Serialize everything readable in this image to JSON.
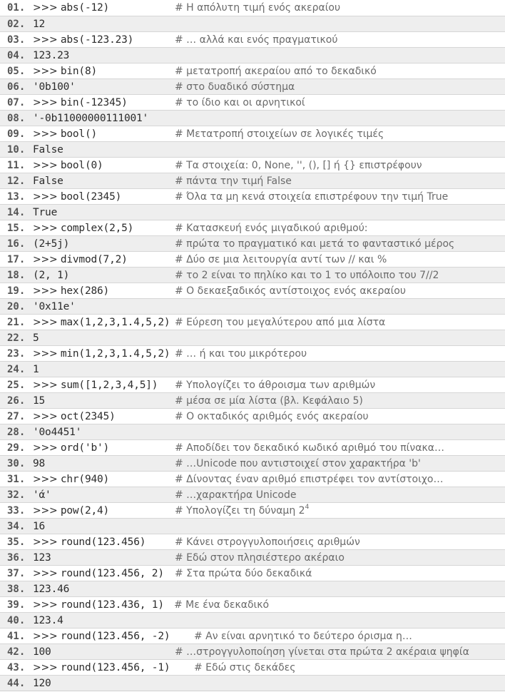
{
  "listing": {
    "lines": [
      {
        "num": "01.",
        "prompt": ">>>",
        "code": "abs(-12)",
        "comment": "# Η απόλυτη τιμή ενός ακεραίου"
      },
      {
        "num": "02.",
        "prompt": "",
        "code": "12",
        "comment": ""
      },
      {
        "num": "03.",
        "prompt": ">>>",
        "code": "abs(-123.23)",
        "comment": "# … αλλά και ενός πραγματικού"
      },
      {
        "num": "04.",
        "prompt": "",
        "code": "123.23",
        "comment": ""
      },
      {
        "num": "05.",
        "prompt": ">>>",
        "code": "bin(8)",
        "comment": "# μετατροπή ακεραίου από το δεκαδικό"
      },
      {
        "num": "06.",
        "prompt": "",
        "code": "'0b100'",
        "comment": "# στο δυαδικό σύστημα"
      },
      {
        "num": "07.",
        "prompt": ">>>",
        "code": "bin(-12345)",
        "comment": "# το ίδιο και οι αρνητικοί"
      },
      {
        "num": "08.",
        "prompt": "",
        "code": "'-0b11000000111001'",
        "comment": ""
      },
      {
        "num": "09.",
        "prompt": ">>>",
        "code": "bool()",
        "comment": "# Μετατροπή στοιχείων σε λογικές τιμές"
      },
      {
        "num": "10.",
        "prompt": "",
        "code": "False",
        "comment": ""
      },
      {
        "num": "11.",
        "prompt": ">>>",
        "code": "bool(0)",
        "comment": "# Τα στοιχεία: 0, None, '', (), [] ή {} επιστρέφουν"
      },
      {
        "num": "12.",
        "prompt": "",
        "code": "False",
        "comment": "# πάντα την τιμή False"
      },
      {
        "num": "13.",
        "prompt": ">>>",
        "code": "bool(2345)",
        "comment": "# Όλα τα μη κενά στοιχεία επιστρέφουν την τιμή True"
      },
      {
        "num": "14.",
        "prompt": "",
        "code": "True",
        "comment": ""
      },
      {
        "num": "15.",
        "prompt": ">>>",
        "code": "complex(2,5)",
        "comment": "# Κατασκευή ενός μιγαδικού αριθμού:"
      },
      {
        "num": "16.",
        "prompt": "",
        "code": "(2+5j)",
        "comment": "# πρώτα το πραγματικό και μετά το φανταστικό μέρος"
      },
      {
        "num": "17.",
        "prompt": ">>>",
        "code": "divmod(7,2)",
        "comment": "# Δύο σε μια λειτουργία αντί των // και %"
      },
      {
        "num": "18.",
        "prompt": "",
        "code": "(2, 1)",
        "comment": "# το 2 είναι το πηλίκο και το 1 το υπόλοιπο του 7//2"
      },
      {
        "num": "19.",
        "prompt": ">>>",
        "code": "hex(286)",
        "comment": "# Ο δεκαεξαδικός αντίστοιχος ενός ακεραίου"
      },
      {
        "num": "20.",
        "prompt": "",
        "code": "'0x11e'",
        "comment": ""
      },
      {
        "num": "21.",
        "prompt": ">>>",
        "code": "max(1,2,3,1.4,5,2)",
        "comment": "# Εύρεση του μεγαλύτερου από μια λίστα"
      },
      {
        "num": "22.",
        "prompt": "",
        "code": "5",
        "comment": ""
      },
      {
        "num": "23.",
        "prompt": ">>>",
        "code": "min(1,2,3,1.4,5,2)",
        "comment": "# … ή και του μικρότερου"
      },
      {
        "num": "24.",
        "prompt": "",
        "code": "1",
        "comment": ""
      },
      {
        "num": "25.",
        "prompt": ">>>",
        "code": "sum([1,2,3,4,5])",
        "comment": "# Υπολογίζει το άθροισμα των αριθμών"
      },
      {
        "num": "26.",
        "prompt": "",
        "code": "15",
        "comment": "# μέσα σε μία λίστα (βλ. Κεφάλαιο 5)"
      },
      {
        "num": "27.",
        "prompt": ">>>",
        "code": "oct(2345)",
        "comment": "# Ο οκταδικός αριθμός ενός ακεραίου"
      },
      {
        "num": "28.",
        "prompt": "",
        "code": "'0o4451'",
        "comment": ""
      },
      {
        "num": "29.",
        "prompt": ">>>",
        "code": "ord('b')",
        "comment": "# Αποδίδει τον δεκαδικό κωδικό αριθμό του πίνακα…"
      },
      {
        "num": "30.",
        "prompt": "",
        "code": "98",
        "comment": "# …Unicode που αντιστοιχεί στον χαρακτήρα 'b'"
      },
      {
        "num": "31.",
        "prompt": ">>>",
        "code": "chr(940)",
        "comment": "# Δίνοντας έναν αριθμό επιστρέφει τον αντίστοιχο…"
      },
      {
        "num": "32.",
        "prompt": "",
        "code": "'ά'",
        "comment": "# …χαρακτήρα Unicode"
      },
      {
        "num": "33.",
        "prompt": ">>>",
        "code": "pow(2,4)",
        "comment": "# Υπολογίζει τη δύναμη 2",
        "sup": "4"
      },
      {
        "num": "34.",
        "prompt": "",
        "code": "16",
        "comment": ""
      },
      {
        "num": "35.",
        "prompt": ">>>",
        "code": "round(123.456)",
        "comment": "# Κάνει στρογγυλοποιήσεις αριθμών"
      },
      {
        "num": "36.",
        "prompt": "",
        "code": "123",
        "comment": "# Εδώ στον πλησιέστερο ακέραιο"
      },
      {
        "num": "37.",
        "prompt": ">>>",
        "code": "round(123.456, 2)",
        "comment": "# Στα πρώτα δύο δεκαδικά"
      },
      {
        "num": "38.",
        "prompt": "",
        "code": "123.46",
        "comment": ""
      },
      {
        "num": "39.",
        "prompt": ">>>",
        "code": "round(123.436, 1)",
        "comment": "# Με ένα δεκαδικό"
      },
      {
        "num": "40.",
        "prompt": "",
        "code": "123.4",
        "comment": ""
      },
      {
        "num": "41.",
        "prompt": ">>>",
        "code": "round(123.456, -2)",
        "comment": "# Αν είναι αρνητικό το δεύτερο όρισμα η…"
      },
      {
        "num": "42.",
        "prompt": "",
        "code": "100",
        "comment": "# …στρογγυλοποίηση γίνεται στα πρώτα 2 ακέραια ψηφία"
      },
      {
        "num": "43.",
        "prompt": ">>>",
        "code": "round(123.456, -1)",
        "comment": "# Εδώ στις δεκάδες"
      },
      {
        "num": "44.",
        "prompt": "",
        "code": "120",
        "comment": ""
      }
    ]
  },
  "colors": {
    "row_even": "#eeeeee",
    "row_odd": "#ffffff",
    "line_number": "#555555",
    "comment": "#6a6a6a"
  }
}
